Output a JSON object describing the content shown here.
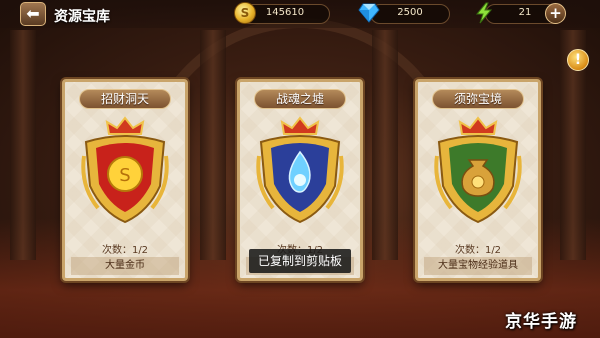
{
  "header": {
    "back_icon": "back-arrow-icon",
    "title": "资源宝库"
  },
  "resources": {
    "gold": {
      "icon": "gold-coin-icon",
      "value": "145610"
    },
    "gems": {
      "icon": "diamond-icon",
      "value": "2500"
    },
    "energy": {
      "icon": "lightning-icon",
      "value": "21",
      "add_icon": "plus-icon"
    }
  },
  "info_icon": "exclamation-icon",
  "cards": [
    {
      "title": "招财洞天",
      "count_label": "次数：1/2",
      "reward": "大量金币",
      "emblem_color": "#c8221b",
      "emblem_icon": "gold-coin-icon"
    },
    {
      "title": "战魂之墟",
      "count_label": "次数：1/2",
      "reward": "",
      "emblem_color": "#2b3f9a",
      "emblem_icon": "blue-flame-icon"
    },
    {
      "title": "须弥宝境",
      "count_label": "次数：1/2",
      "reward": "大量宝物经验道具",
      "emblem_color": "#3d7a2a",
      "emblem_icon": "treasure-bag-icon"
    }
  ],
  "toast": "已复制到剪贴板",
  "watermark": "京华手游"
}
